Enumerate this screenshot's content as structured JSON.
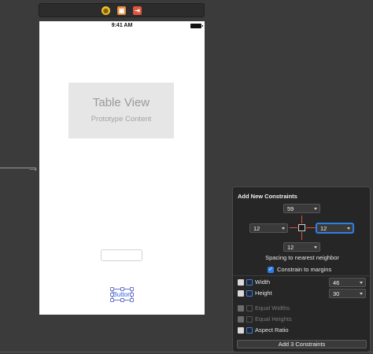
{
  "toolbar": {
    "icons": [
      "view-controller-icon",
      "first-responder-icon",
      "exit-icon"
    ]
  },
  "canvas": {
    "status_time": "9:41 AM",
    "table_view": {
      "title": "Table View",
      "subtitle": "Prototype Content"
    },
    "button_label": "Button"
  },
  "constraints_popover": {
    "title": "Add New Constraints",
    "top_value": "59",
    "left_value": "12",
    "right_value": "12",
    "bottom_value": "12",
    "spacing_label": "Spacing to nearest neighbor",
    "constrain_to_margins_label": "Constrain to margins",
    "constrain_to_margins_checked": true,
    "width_label": "Width",
    "width_value": "46",
    "height_label": "Height",
    "height_value": "30",
    "equal_widths_label": "Equal Widths",
    "equal_heights_label": "Equal Heights",
    "aspect_ratio_label": "Aspect Ratio",
    "add_button_label": "Add 3 Constraints"
  },
  "colors": {
    "canvas_background": "#3b3b3b",
    "popover_background": "#262626",
    "focus_blue": "#2f7fe3",
    "strut_red": "#e44b3b",
    "selection_purple": "#6b75c9"
  }
}
